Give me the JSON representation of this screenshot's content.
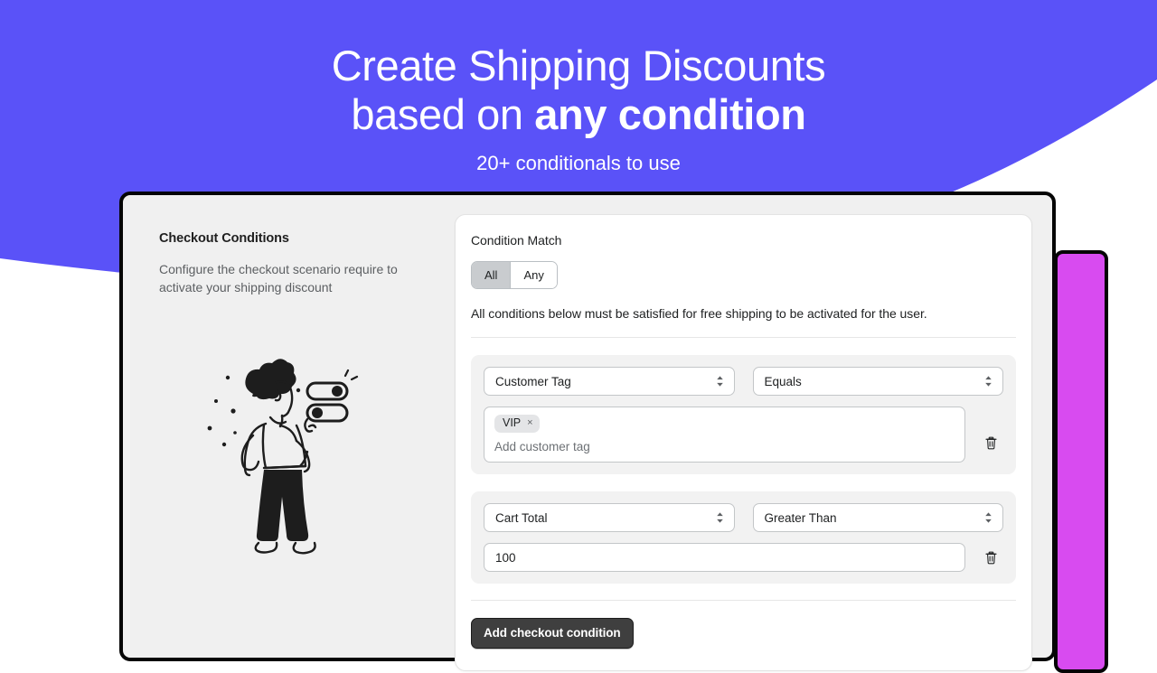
{
  "hero": {
    "line1": "Create Shipping Discounts",
    "line2_prefix": "based on ",
    "line2_strong": "any condition",
    "subtitle": "20+ conditionals to use"
  },
  "colors": {
    "hero_background": "#5A52F8",
    "page_background": "#FFFFFF",
    "accent_panel": "#D84BF0",
    "window_border": "#050505",
    "window_background": "#F0F0F0",
    "card_background": "#FFFFFF",
    "group_background": "#F2F2F2",
    "primary_button": "#3F3F3F",
    "segment_active": "#C9CCCF",
    "chip_background": "#E4E5E7"
  },
  "sidebar": {
    "title": "Checkout Conditions",
    "description": "Configure the checkout scenario require to activate your shipping discount",
    "illustration_name": "person-toggling-switches-illustration"
  },
  "card": {
    "label": "Condition Match",
    "segmented": {
      "options": [
        "All",
        "Any"
      ],
      "selected": "All"
    },
    "help_text": "All conditions below must be satisfied for free shipping to be activated for the user.",
    "conditions": [
      {
        "field": "Customer Tag",
        "operator": "Equals",
        "value_type": "tags",
        "tags": [
          "VIP"
        ],
        "tag_remove_label": "×",
        "placeholder": "Add customer tag",
        "delete_label": "trash-icon"
      },
      {
        "field": "Cart Total",
        "operator": "Greater Than",
        "value_type": "text",
        "value": "100",
        "delete_label": "trash-icon"
      }
    ],
    "add_button": "Add checkout condition"
  }
}
